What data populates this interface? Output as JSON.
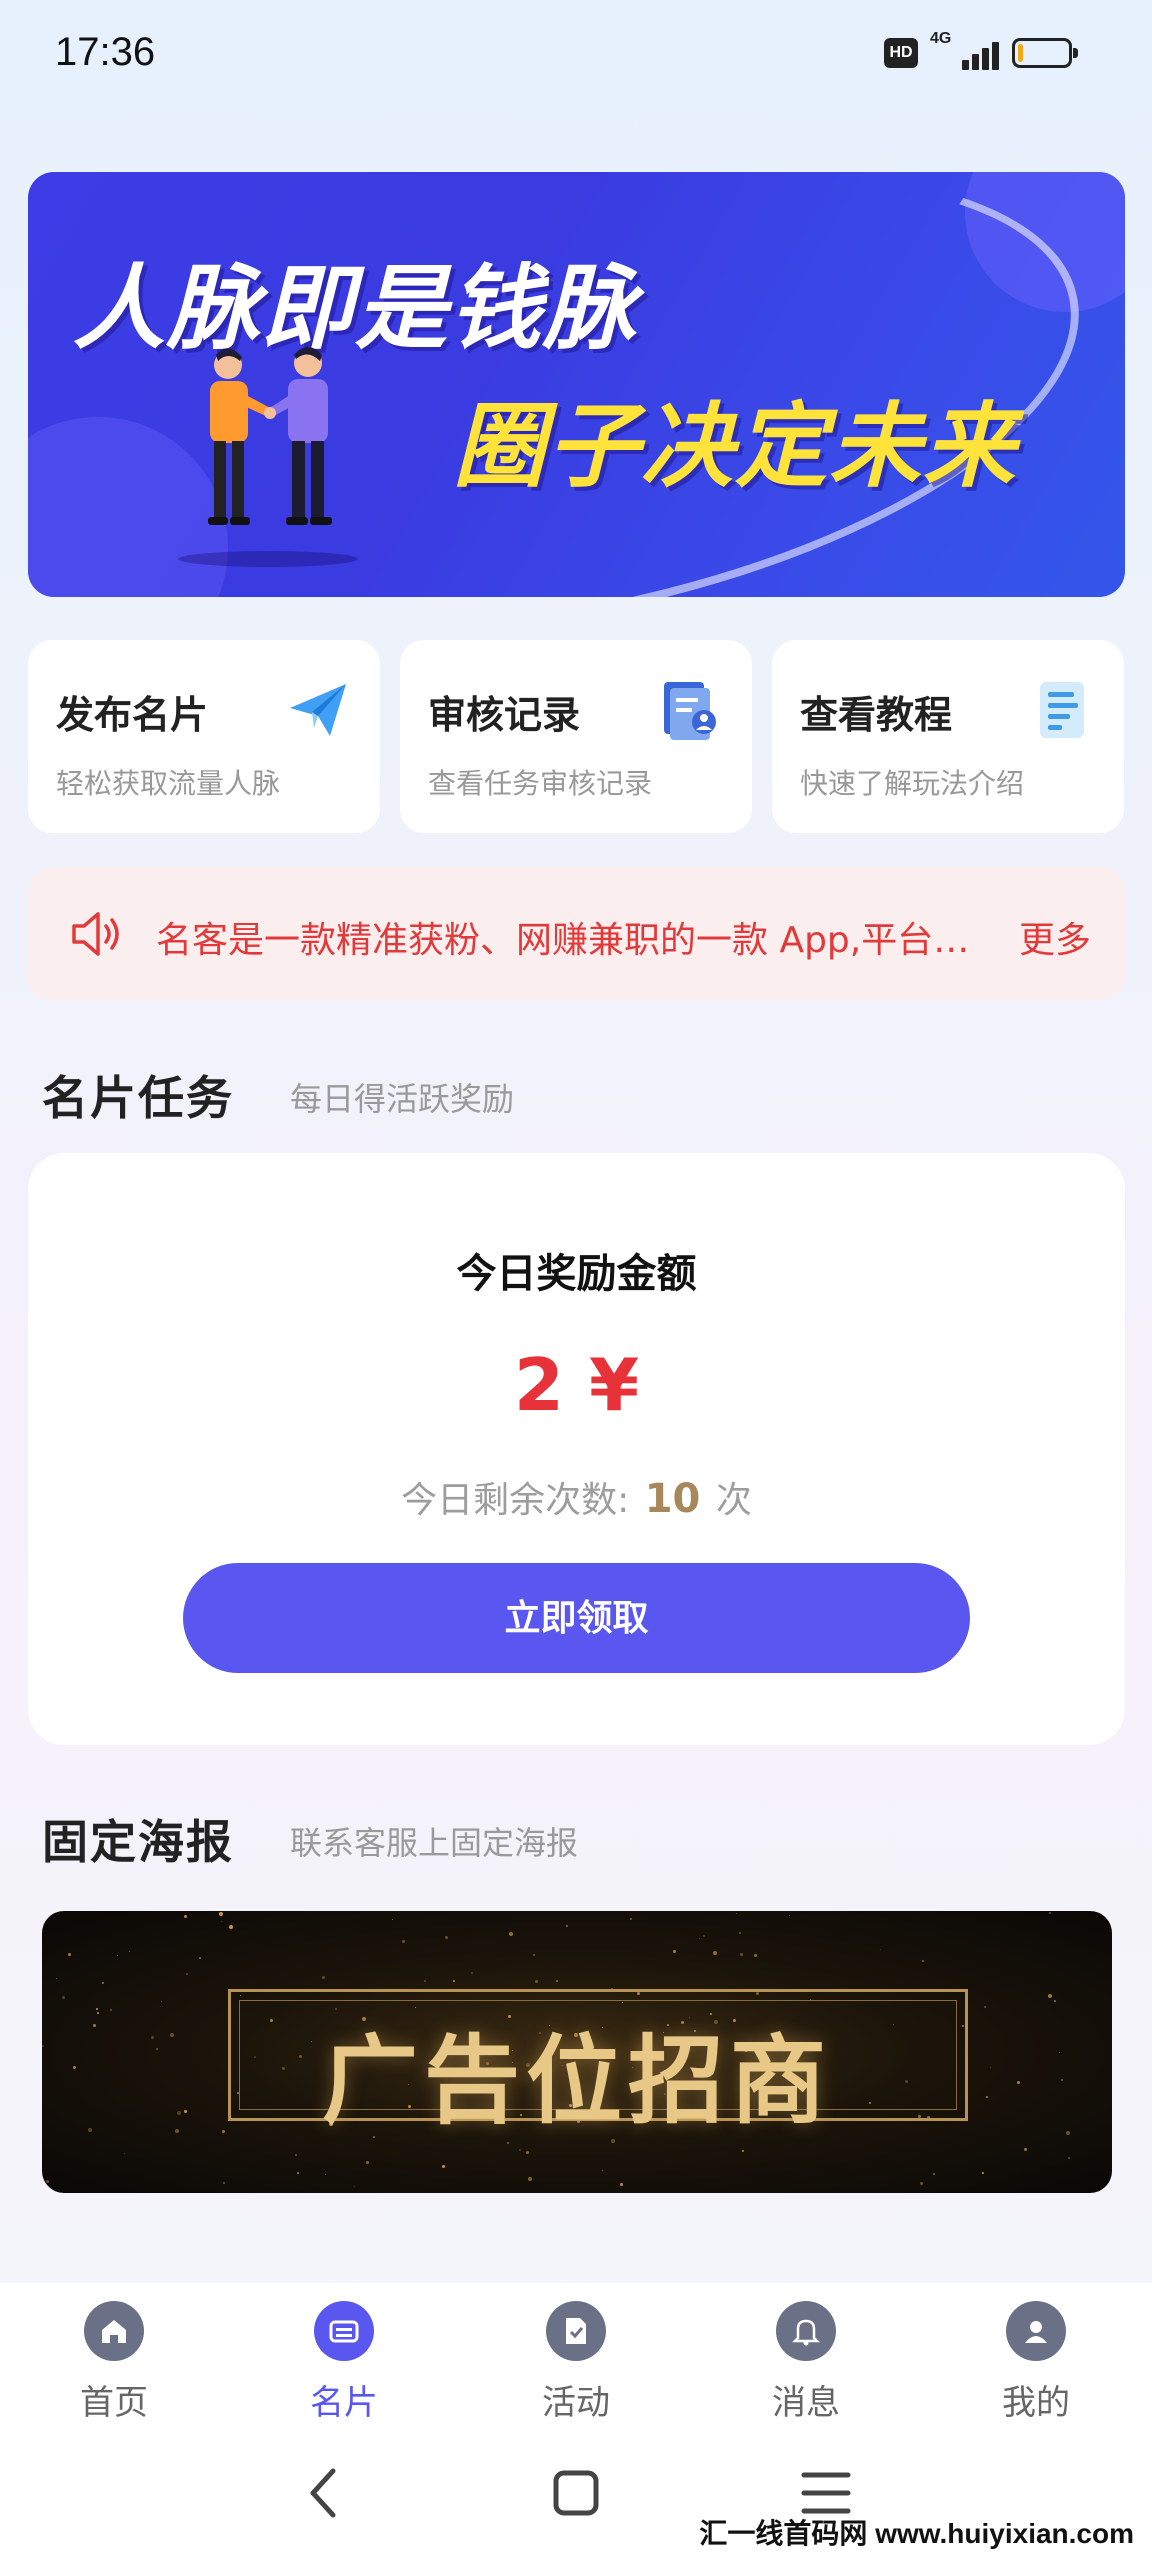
{
  "status_bar": {
    "time": "17:36",
    "hd": "HD",
    "network": "4G",
    "battery_level": 0.1
  },
  "banner": {
    "line1": "人脉即是钱脉",
    "line2": "圈子决定未来"
  },
  "quick_actions": [
    {
      "title": "发布名片",
      "subtitle": "轻松获取流量人脉",
      "icon": "paper-plane-icon"
    },
    {
      "title": "审核记录",
      "subtitle": "查看任务审核记录",
      "icon": "document-user-icon"
    },
    {
      "title": "查看教程",
      "subtitle": "快速了解玩法介绍",
      "icon": "document-icon"
    }
  ],
  "notice": {
    "text": "名客是一款精准获粉、网赚兼职的一款 App,平台…",
    "more": "更多"
  },
  "task_section": {
    "title": "名片任务",
    "subtitle": "每日得活跃奖励"
  },
  "reward": {
    "label": "今日奖励金额",
    "amount": "2 ¥",
    "remain_prefix": "今日剩余次数:",
    "remain_count": "10",
    "remain_suffix": "次",
    "claim_label": "立即领取"
  },
  "poster_section": {
    "title": "固定海报",
    "subtitle": "联系客服上固定海报",
    "poster_text": "广告位招商"
  },
  "tabbar": {
    "items": [
      {
        "label": "首页",
        "icon": "home-icon",
        "active": false
      },
      {
        "label": "名片",
        "icon": "card-icon",
        "active": true
      },
      {
        "label": "活动",
        "icon": "activity-icon",
        "active": false
      },
      {
        "label": "消息",
        "icon": "bell-icon",
        "active": false
      },
      {
        "label": "我的",
        "icon": "profile-icon",
        "active": false
      }
    ]
  },
  "watermark": "汇一线首码网 www.huiyixian.com",
  "colors": {
    "accent": "#5a57f0",
    "alert": "#e23a3a",
    "amount": "#e8323a",
    "banner": "#3d3ce6"
  }
}
